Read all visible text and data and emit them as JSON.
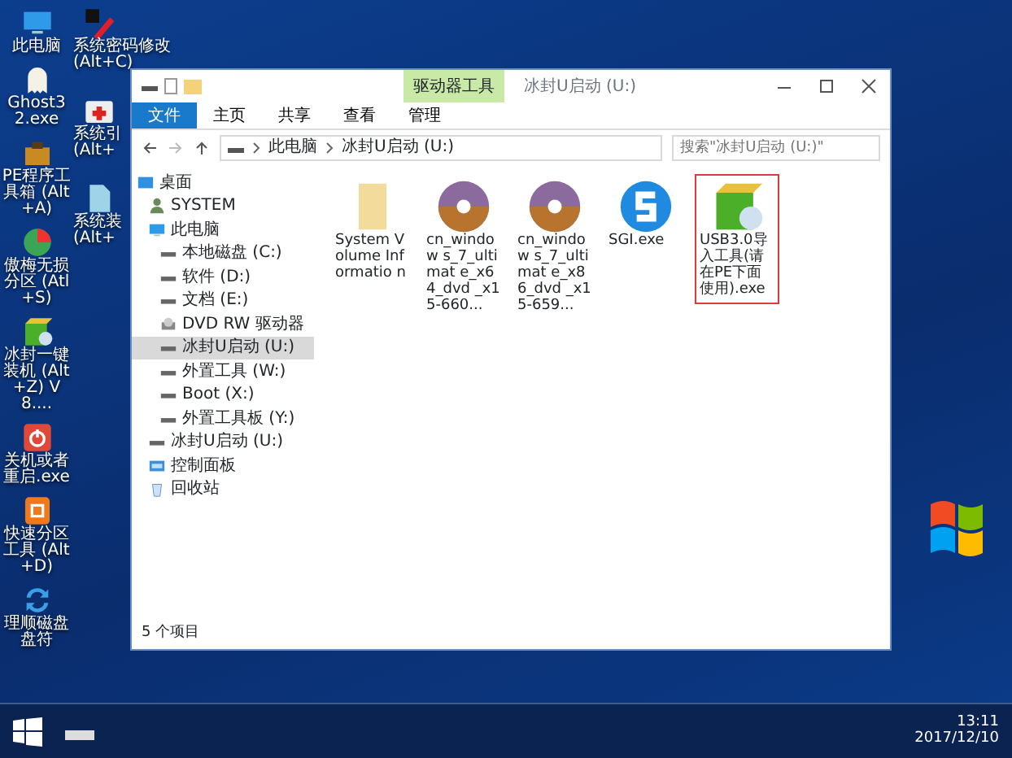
{
  "desktop": {
    "icons": [
      {
        "kind": "pc",
        "label": "此电脑"
      },
      {
        "kind": "ghost",
        "label": "Ghost32.exe"
      },
      {
        "kind": "toolbox",
        "label": "PE程序工具箱 (Alt+A)"
      },
      {
        "kind": "partition",
        "label": "傲梅无损分区 (Atl+S)"
      },
      {
        "kind": "installer",
        "label": "冰封一键装机 (Alt+Z) V8...."
      },
      {
        "kind": "power",
        "label": "关机或者重启.exe"
      },
      {
        "kind": "quickpart",
        "label": "快速分区工具 (Alt+D)"
      },
      {
        "kind": "refresh",
        "label": "理顺磁盘盘符"
      }
    ],
    "icons_2": [
      {
        "kind": "password",
        "label": "系统密码修改 (Alt+C)"
      },
      {
        "kind": "repair",
        "label": "系统引 (Alt+"
      },
      {
        "kind": "file",
        "label": "系统装 (Alt+"
      }
    ]
  },
  "window": {
    "title": "冰封U启动 (U:)",
    "context_tab": "驱动器工具",
    "ribbon_tabs": [
      {
        "label": "文件",
        "selected": true
      },
      {
        "label": "主页",
        "selected": false
      },
      {
        "label": "共享",
        "selected": false
      },
      {
        "label": "查看",
        "selected": false
      },
      {
        "label": "管理",
        "selected": false
      }
    ],
    "breadcrumb": [
      "此电脑",
      "冰封U启动 (U:)"
    ],
    "search": {
      "placeholder": "搜索\"冰封U启动 (U:)\""
    },
    "nav": [
      {
        "kind": "desktop",
        "label": "桌面",
        "selected": false,
        "children": [
          {
            "kind": "user",
            "label": "SYSTEM",
            "selected": false
          },
          {
            "kind": "pc",
            "label": "此电脑",
            "selected": false,
            "children": [
              {
                "kind": "drive",
                "label": "本地磁盘 (C:)",
                "selected": false
              },
              {
                "kind": "drive",
                "label": "软件 (D:)",
                "selected": false
              },
              {
                "kind": "drive",
                "label": "文档 (E:)",
                "selected": false
              },
              {
                "kind": "dvd",
                "label": "DVD RW 驱动器",
                "selected": false
              },
              {
                "kind": "drive",
                "label": "冰封U启动 (U:)",
                "selected": true
              },
              {
                "kind": "drive",
                "label": "外置工具 (W:)",
                "selected": false
              },
              {
                "kind": "drive",
                "label": "Boot (X:)",
                "selected": false
              },
              {
                "kind": "drive",
                "label": "外置工具板 (Y:)",
                "selected": false
              }
            ]
          },
          {
            "kind": "drive",
            "label": "冰封U启动 (U:)",
            "selected": false
          },
          {
            "kind": "panel",
            "label": "控制面板",
            "selected": false
          },
          {
            "kind": "recycle",
            "label": "回收站",
            "selected": false
          }
        ]
      }
    ],
    "files": [
      {
        "kind": "folder",
        "name": "System Volume Informatio n",
        "selected": false
      },
      {
        "kind": "disc",
        "name": "cn_window s_7_ultimat e_x64_dvd _x15-660...",
        "selected": false
      },
      {
        "kind": "disc",
        "name": "cn_window s_7_ultimat e_x86_dvd _x15-659...",
        "selected": false
      },
      {
        "kind": "sgi",
        "name": "SGI.exe",
        "selected": false
      },
      {
        "kind": "installer",
        "name": "USB3.0导入工具(请在PE下面使用).exe",
        "selected": true
      }
    ],
    "status_bar": "5 个项目"
  },
  "taskbar": {
    "time": "13:11",
    "date": "2017/12/10"
  }
}
